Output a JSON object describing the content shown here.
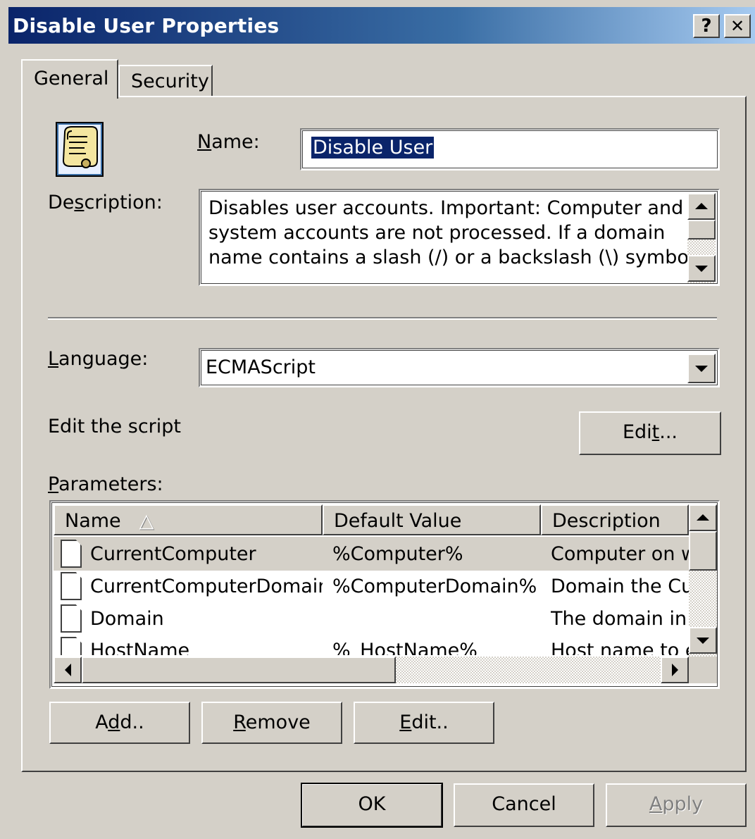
{
  "window": {
    "title": "Disable User Properties",
    "help_label": "?",
    "close_label": "✕"
  },
  "tabs": [
    {
      "label": "General"
    },
    {
      "label": "Security"
    }
  ],
  "general": {
    "name_label_u": "N",
    "name_label_rest": "ame:",
    "name_value": "Disable User",
    "description_label_pre": "De",
    "description_label_u": "s",
    "description_label_rest": "cription:",
    "description_lines": [
      "Disables user accounts. Important: Computer and",
      "system accounts are not processed. If a domain",
      "name contains a slash (/) or a backslash (\\) symbol,"
    ],
    "language_label_u": "L",
    "language_label_rest": "anguage:",
    "language_value": "ECMAScript",
    "edit_script_label": "Edit the script",
    "edit_button_pre": "Edi",
    "edit_button_u": "t",
    "edit_button_rest": "...",
    "parameters_label_u": "P",
    "parameters_label_rest": "arameters:"
  },
  "parameters_table": {
    "columns": [
      "Name",
      "Default Value",
      "Description"
    ],
    "sort_indicator": "△",
    "rows": [
      {
        "name": "CurrentComputer",
        "default": "%Computer%",
        "description": "Computer on w"
      },
      {
        "name": "CurrentComputerDomain",
        "default": "%ComputerDomain%",
        "description": "Domain the Cur"
      },
      {
        "name": "Domain",
        "default": "",
        "description": "The domain in w"
      },
      {
        "name": "HostName",
        "default": "%_HostName%",
        "description": "Host name to e"
      }
    ]
  },
  "param_buttons": {
    "add_pre": "A",
    "add_u": "d",
    "add_rest": "d..",
    "remove_u": "R",
    "remove_rest": "emove",
    "edit_u": "E",
    "edit_rest": "dit.."
  },
  "dialog_buttons": {
    "ok": "OK",
    "cancel": "Cancel",
    "apply_u": "A",
    "apply_rest": "pply"
  },
  "colors": {
    "title_start": "#0a246a",
    "title_end": "#a6caf0",
    "face": "#d4d0c8",
    "selection": "#0a246a"
  }
}
